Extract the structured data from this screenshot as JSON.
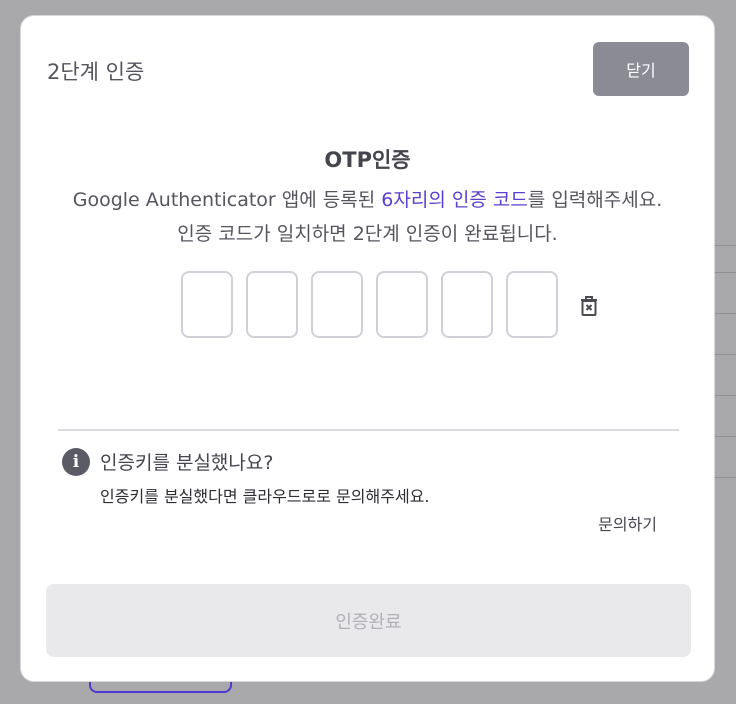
{
  "modal": {
    "title": "2단계 인증",
    "close_label": "닫기"
  },
  "otp": {
    "heading": "OTP인증",
    "desc_prefix": "Google Authenticator 앱에 등록된 ",
    "desc_highlight": "6자리의 인증 코드",
    "desc_suffix": "를 입력해주세요.",
    "desc_line2": "인증 코드가 일치하면 2단계 인증이 완료됩니다.",
    "digits": [
      "",
      "",
      "",
      "",
      "",
      ""
    ]
  },
  "info": {
    "icon": "info-icon",
    "title": "인증키를 분실했나요?",
    "text": "인증키를 분실했다면 클라우드로로 문의해주세요.",
    "contact_label": "문의하기"
  },
  "submit_label": "인증완료",
  "colors": {
    "accent": "#5a3fd0",
    "close_button": "#8b8b96",
    "submit_disabled": "#e9e9ec"
  }
}
